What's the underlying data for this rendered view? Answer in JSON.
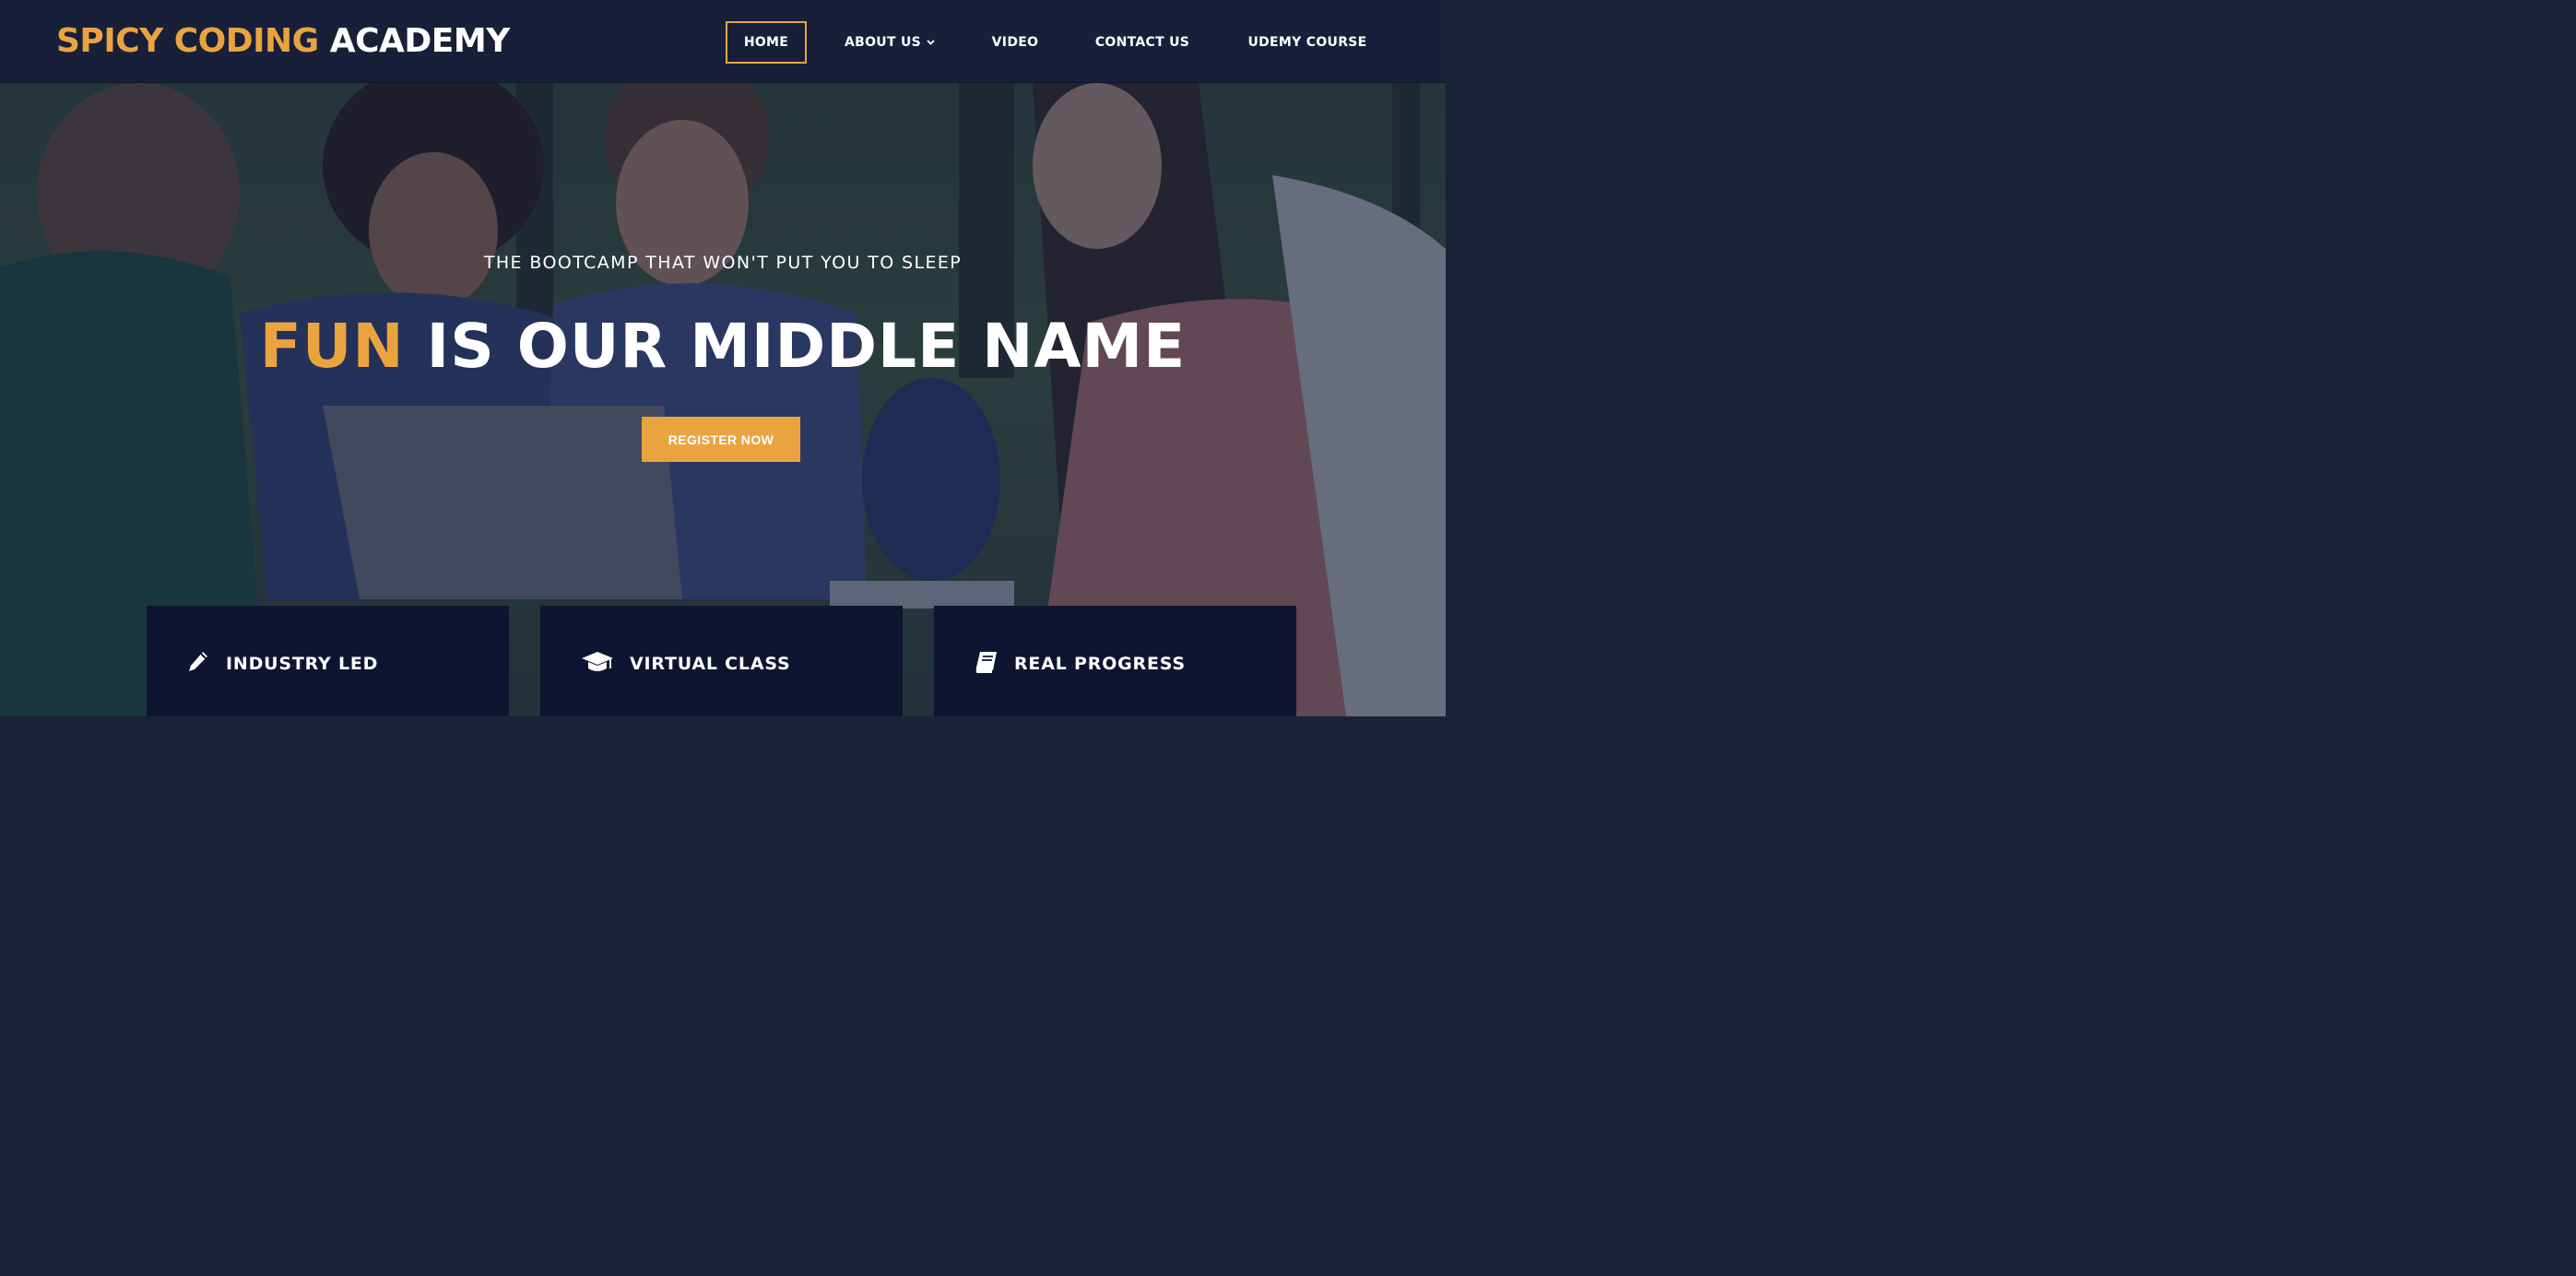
{
  "brand": {
    "accent_part": "SPICY CODING",
    "rest_part": "ACADEMY",
    "accent_color": "#e9a440"
  },
  "nav": {
    "items": [
      {
        "label": "HOME",
        "active": true
      },
      {
        "label": "ABOUT US",
        "has_dropdown": true
      },
      {
        "label": "VIDEO"
      },
      {
        "label": "CONTACT US"
      },
      {
        "label": "UDEMY COURSE"
      }
    ]
  },
  "hero": {
    "subtitle": "THE BOOTCAMP THAT WON'T PUT YOU TO SLEEP",
    "title_accent": "FUN",
    "title_rest": "IS OUR MIDDLE NAME",
    "cta_label": "REGISTER NOW"
  },
  "features": [
    {
      "icon": "pencil-icon",
      "label": "INDUSTRY LED"
    },
    {
      "icon": "graduation-cap-icon",
      "label": "VIRTUAL CLASS"
    },
    {
      "icon": "book-icon",
      "label": "REAL PROGRESS"
    }
  ],
  "colors": {
    "nav_background": "#182039",
    "card_background": "#0f1530",
    "accent": "#e9a440"
  }
}
